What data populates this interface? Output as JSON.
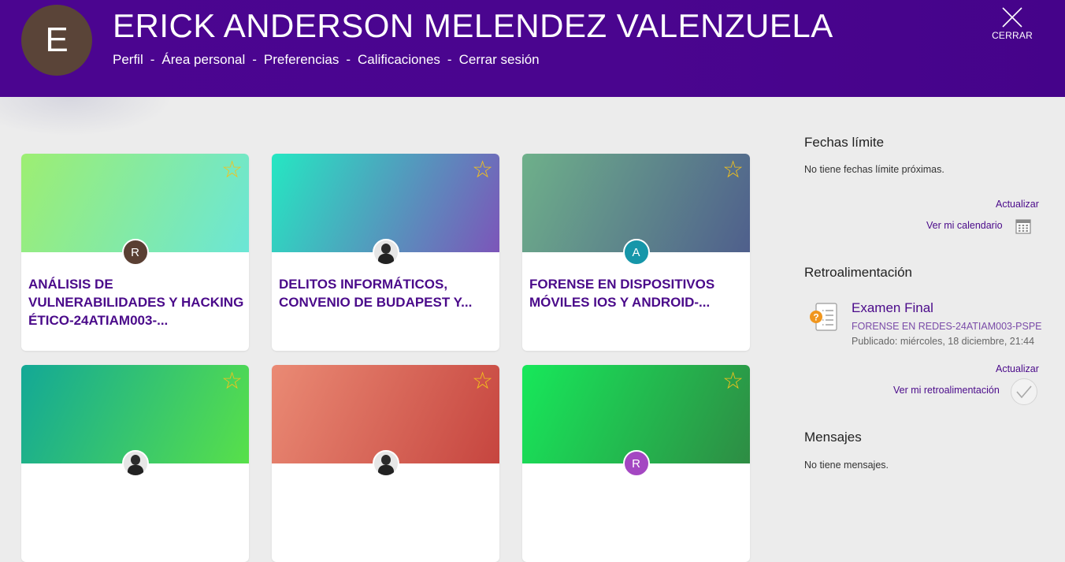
{
  "header": {
    "avatar_letter": "E",
    "user_name": "ERICK ANDERSON MELENDEZ VALENZUELA",
    "nav": [
      "Perfil",
      "Área personal",
      "Preferencias",
      "Calificaciones",
      "Cerrar sesión"
    ],
    "nav_separator": "-",
    "close_icon": "close-icon",
    "close_label": "CERRAR"
  },
  "courses": [
    {
      "title": "ANÁLISIS DE VULNERABILIDADES Y HACKING ÉTICO-24ATIAM003-...",
      "avatar_letter": "R",
      "avatar_color": "#5a3f33",
      "gradient": [
        "#9dee72",
        "#6be6d6"
      ]
    },
    {
      "title": "DELITOS INFORMÁTICOS, CONVENIO DE BUDAPEST Y...",
      "avatar_letter": "",
      "avatar_color": "#e6e6e6",
      "gradient": [
        "#25e7c2",
        "#7c55b9"
      ]
    },
    {
      "title": "FORENSE EN DISPOSITIVOS MÓVILES IOS Y ANDROID-...",
      "avatar_letter": "A",
      "avatar_color": "#1696a9",
      "gradient": [
        "#6eb08a",
        "#4f5f8c"
      ]
    },
    {
      "title": "",
      "avatar_letter": "",
      "avatar_color": "#e6e6e6",
      "gradient": [
        "#13a896",
        "#58e04a"
      ]
    },
    {
      "title": "",
      "avatar_letter": "",
      "avatar_color": "#e6e6e6",
      "gradient": [
        "#ea8a74",
        "#c6453f"
      ]
    },
    {
      "title": "",
      "avatar_letter": "R",
      "avatar_color": "#a447c2",
      "gradient": [
        "#17e85a",
        "#2e8c44"
      ]
    }
  ],
  "sidebar": {
    "deadlines": {
      "title": "Fechas límite",
      "empty_text": "No tiene fechas límite próximas.",
      "refresh_label": "Actualizar",
      "calendar_link": "Ver mi calendario",
      "calendar_icon": "calendar-icon"
    },
    "feedback": {
      "title": "Retroalimentación",
      "item_title": "Examen Final",
      "item_course": "FORENSE EN REDES-24ATIAM003-PSPE-",
      "item_published": "Publicado: miércoles, 18 diciembre, 21:44",
      "item_icon": "quiz-icon",
      "refresh_label": "Actualizar",
      "feedback_link": "Ver mi retroalimentación",
      "check_icon": "checkmark-icon"
    },
    "messages": {
      "title": "Mensajes",
      "empty_text": "No tiene mensajes."
    }
  },
  "colors": {
    "header_bg": "#4b0590",
    "accent": "#4a0a8a",
    "star": "#f4c21b",
    "quiz_badge": "#f0961e"
  }
}
